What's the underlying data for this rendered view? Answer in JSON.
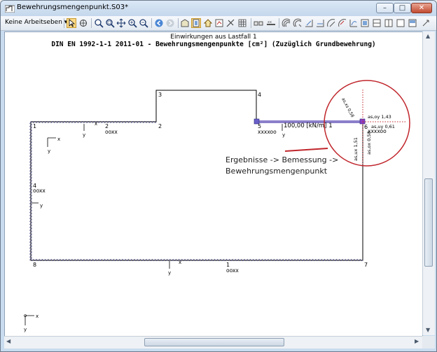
{
  "window": {
    "title": "Bewehrungsmengenpunkt.S03*",
    "buttons": {
      "minimize": "–",
      "maximize": "□",
      "close": "✕"
    }
  },
  "toolbar": {
    "layer_dropdown": "Keine Arbeitseben ▾",
    "icons": [
      "pointer-icon",
      "select-icon",
      "zoom-icon",
      "zoom-window-icon",
      "pan-icon",
      "zoom-in-icon",
      "zoom-out-icon",
      "back-icon",
      "forward-icon",
      "model-icon",
      "view-icon",
      "home-icon",
      "results-icon",
      "settings-icon",
      "grid-icon",
      "element-icon",
      "member-icon",
      "support-icon",
      "load-icon",
      "tb-icon-1",
      "tb-icon-2",
      "tb-icon-3",
      "tb-icon-4",
      "tb-icon-5",
      "tb-icon-6",
      "tb-icon-7",
      "tb-icon-8",
      "tb-icon-9"
    ]
  },
  "drawing": {
    "heading": "Einwirkungen aus Lastfall 1",
    "subheading": "DIN  EN  1992-1-1  2011-01  -  Bewehrungsmengenpunkte  [cm²]  (Zuzüglich  Grundbewehrung)",
    "node_labels": [
      "1",
      "2",
      "2",
      "3",
      "4",
      "5",
      "6",
      "7",
      "8",
      "1",
      "4"
    ],
    "member_labels": [
      "ooxx",
      "xxxxoo",
      "xxxxoo",
      "ooxx",
      "ooxx"
    ],
    "load_label": "100,00 [kN/m] 1",
    "axis": {
      "x": "x",
      "y": "y"
    },
    "point_values": {
      "asxs": "as,xs 0,58",
      "asoy": "as,oy 1,43",
      "asuy": "as,uy 0,61",
      "asux": "as,ux 1,51",
      "asox": "as,ox 0,58"
    },
    "annotation_lines": [
      "Ergebnisse -> Bemessung ->",
      "Bewehrungsmengenpunkt"
    ]
  },
  "colors": {
    "structure": "#000000",
    "support": "#2b2b7a",
    "load": "#8b7fc9",
    "highlight": "#c0262c",
    "active_tool": "#fbd885"
  }
}
